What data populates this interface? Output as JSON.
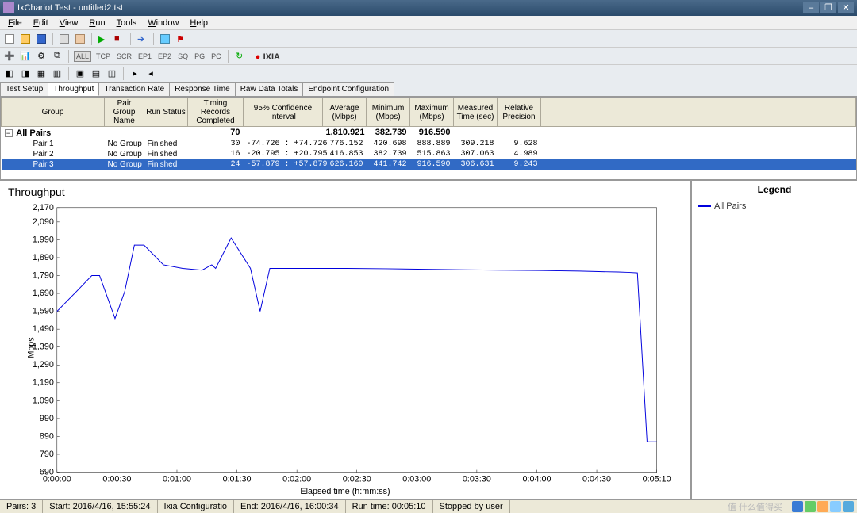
{
  "window": {
    "title": "IxChariot Test - untitled2.tst",
    "min": "–",
    "max": "❐",
    "close": "✕"
  },
  "menus": [
    "File",
    "Edit",
    "View",
    "Run",
    "Tools",
    "Window",
    "Help"
  ],
  "toolbar2_buttons": [
    "ALL",
    "TCP",
    "SCR",
    "EP1",
    "EP2",
    "SQ",
    "PG",
    "PC"
  ],
  "brand": {
    "pre": "●",
    "name": "IXIA"
  },
  "tabs": [
    "Test Setup",
    "Throughput",
    "Transaction Rate",
    "Response Time",
    "Raw Data Totals",
    "Endpoint Configuration"
  ],
  "active_tab": 1,
  "grid": {
    "headers": [
      "Group",
      "Pair Group Name",
      "Run Status",
      "Timing Records Completed",
      "95% Confidence Interval",
      "Average (Mbps)",
      "Minimum (Mbps)",
      "Maximum (Mbps)",
      "Measured Time (sec)",
      "Relative Precision"
    ],
    "summary": {
      "label": "All Pairs",
      "count": "70",
      "avg": "1,810.921",
      "min": "382.739",
      "max": "916.590"
    },
    "rows": [
      {
        "name": "Pair 1",
        "grp": "No Group",
        "status": "Finished",
        "rec": "30",
        "ci": "-74.726 : +74.726",
        "avg": "776.152",
        "min": "420.698",
        "max": "888.889",
        "time": "309.218",
        "prec": "9.628",
        "sel": false
      },
      {
        "name": "Pair 2",
        "grp": "No Group",
        "status": "Finished",
        "rec": "16",
        "ci": "-20.795 : +20.795",
        "avg": "416.853",
        "min": "382.739",
        "max": "515.863",
        "time": "307.063",
        "prec": "4.989",
        "sel": false
      },
      {
        "name": "Pair 3",
        "grp": "No Group",
        "status": "Finished",
        "rec": "24",
        "ci": "-57.879 : +57.879",
        "avg": "626.160",
        "min": "441.742",
        "max": "916.590",
        "time": "306.631",
        "prec": "9.243",
        "sel": true
      }
    ]
  },
  "chart_data": {
    "type": "line",
    "title": "Throughput",
    "xlabel": "Elapsed time (h:mm:ss)",
    "ylabel": "Mbps",
    "ylim": [
      690,
      2170
    ],
    "yticks": [
      690,
      790,
      890,
      990,
      1090,
      1190,
      1290,
      1390,
      1490,
      1590,
      1690,
      1790,
      1890,
      1990,
      2090,
      2170
    ],
    "xticks": [
      "0:00:00",
      "0:00:30",
      "0:01:00",
      "0:01:30",
      "0:02:00",
      "0:02:30",
      "0:03:00",
      "0:03:30",
      "0:04:00",
      "0:04:30",
      "0:05:10"
    ],
    "x_range_sec": [
      0,
      310
    ],
    "series": [
      {
        "name": "All Pairs",
        "color": "#0000dd",
        "x": [
          0,
          10,
          18,
          22,
          30,
          35,
          40,
          45,
          55,
          65,
          75,
          80,
          82,
          90,
          100,
          105,
          110,
          120,
          130,
          150,
          170,
          190,
          210,
          230,
          250,
          270,
          280,
          290,
          295,
          300,
          305,
          310
        ],
        "y": [
          1590,
          1700,
          1790,
          1790,
          1550,
          1700,
          1960,
          1960,
          1850,
          1830,
          1820,
          1850,
          1830,
          2000,
          1830,
          1590,
          1830,
          1830,
          1830,
          1830,
          1828,
          1825,
          1822,
          1820,
          1818,
          1815,
          1812,
          1810,
          1808,
          1805,
          860,
          860
        ]
      }
    ]
  },
  "legend": {
    "title": "Legend",
    "items": [
      "All Pairs"
    ]
  },
  "status": {
    "pairs": "Pairs: 3",
    "start": "Start: 2016/4/16, 15:55:24",
    "config": "Ixia Configuratio",
    "end": "End: 2016/4/16, 16:00:34",
    "runtime": "Run time: 00:05:10",
    "stopped": "Stopped by user"
  },
  "watermark": "值 什么值得买"
}
